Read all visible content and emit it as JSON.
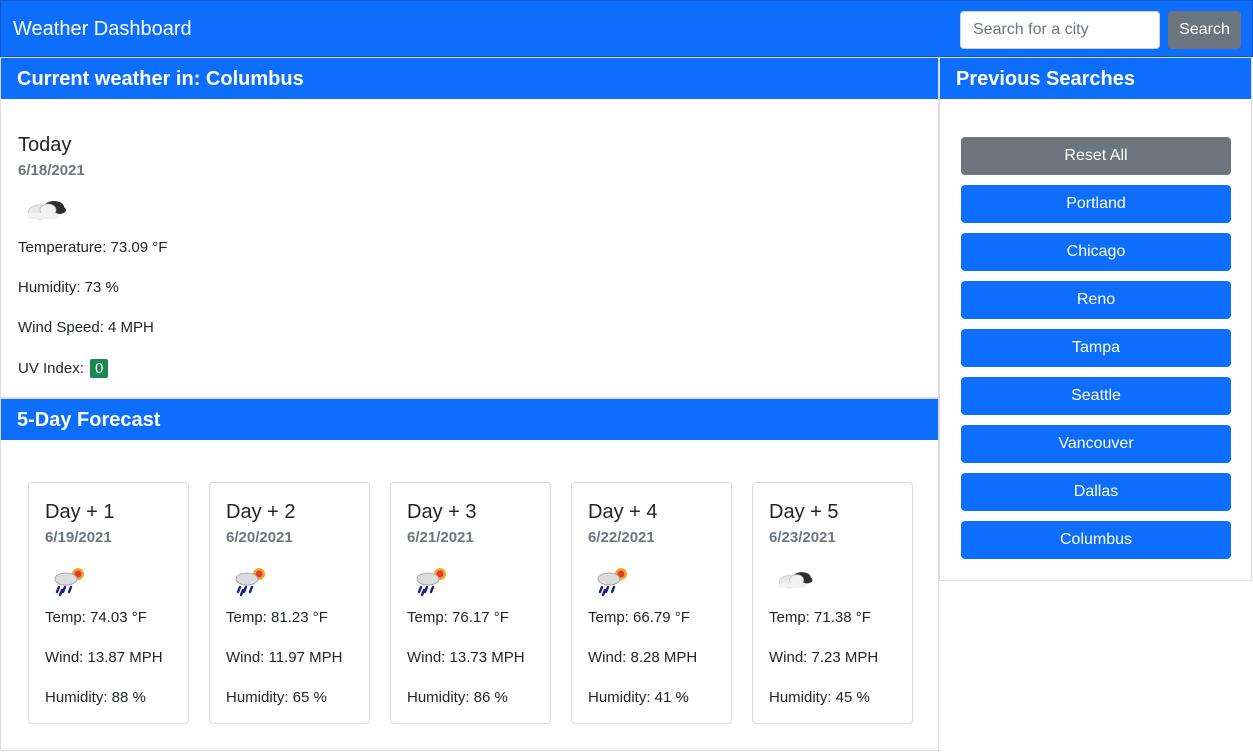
{
  "navbar": {
    "brand": "Weather Dashboard",
    "search_placeholder": "Search for a city",
    "search_button": "Search"
  },
  "current": {
    "header": "Current weather in: Columbus",
    "title": "Today",
    "date": "6/18/2021",
    "icon": "cloud-icon",
    "temperature": "Temperature: 73.09 °F",
    "humidity": "Humidity: 73 %",
    "wind": "Wind Speed: 4 MPH",
    "uv_label": "UV Index:",
    "uv_value": "0",
    "uv_color": "#198754"
  },
  "forecast": {
    "header": "5-Day Forecast",
    "days": [
      {
        "title": "Day + 1",
        "date": "6/19/2021",
        "icon": "rain-sun-icon",
        "temp": "Temp: 74.03 °F",
        "wind": "Wind: 13.87 MPH",
        "humidity": "Humidity: 88 %"
      },
      {
        "title": "Day + 2",
        "date": "6/20/2021",
        "icon": "rain-sun-icon",
        "temp": "Temp: 81.23 °F",
        "wind": "Wind: 11.97 MPH",
        "humidity": "Humidity: 65 %"
      },
      {
        "title": "Day + 3",
        "date": "6/21/2021",
        "icon": "rain-sun-icon",
        "temp": "Temp: 76.17 °F",
        "wind": "Wind: 13.73 MPH",
        "humidity": "Humidity: 86 %"
      },
      {
        "title": "Day + 4",
        "date": "6/22/2021",
        "icon": "rain-sun-icon",
        "temp": "Temp: 66.79 °F",
        "wind": "Wind: 8.28 MPH",
        "humidity": "Humidity: 41 %"
      },
      {
        "title": "Day + 5",
        "date": "6/23/2021",
        "icon": "cloud-icon",
        "temp": "Temp: 71.38 °F",
        "wind": "Wind: 7.23 MPH",
        "humidity": "Humidity: 45 %"
      }
    ]
  },
  "history": {
    "header": "Previous Searches",
    "reset_label": "Reset All",
    "cities": [
      "Portland",
      "Chicago",
      "Reno",
      "Tampa",
      "Seattle",
      "Vancouver",
      "Dallas",
      "Columbus"
    ]
  },
  "colors": {
    "primary": "#0d6efd",
    "secondary": "#6c757d",
    "success": "#198754"
  }
}
